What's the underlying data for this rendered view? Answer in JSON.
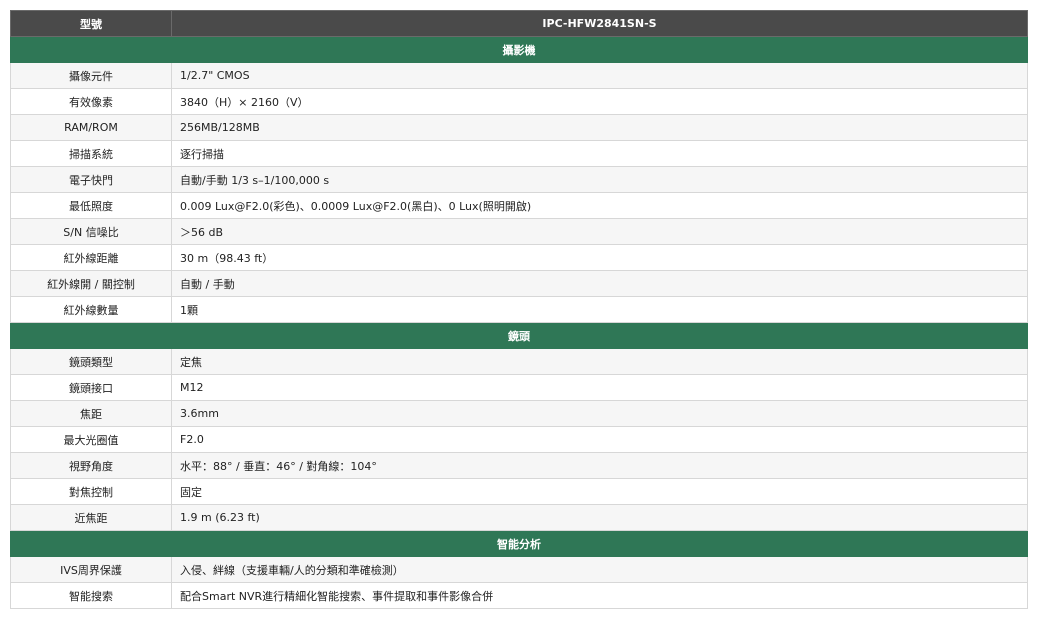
{
  "header": {
    "col1": "型號",
    "col2": "IPC-HFW2841SN-S"
  },
  "sections": [
    {
      "title": "攝影機",
      "rows": [
        {
          "label": "攝像元件",
          "value": "1/2.7\" CMOS"
        },
        {
          "label": "有效像素",
          "value": "3840（H）× 2160（V）"
        },
        {
          "label": "RAM/ROM",
          "value": "256MB/128MB"
        },
        {
          "label": "掃描系統",
          "value": "逐行掃描"
        },
        {
          "label": "電子快門",
          "value": "自動/手動 1/3 s–1/100,000 s"
        },
        {
          "label": "最低照度",
          "value": "0.009 Lux@F2.0(彩色)、0.0009 Lux@F2.0(黑白)、0 Lux(照明開啟)"
        },
        {
          "label": "S/N 信噪比",
          "value": "＞56 dB"
        },
        {
          "label": "紅外線距離",
          "value": "30 m（98.43 ft）"
        },
        {
          "label": "紅外線開 / 關控制",
          "value": "自動 / 手動"
        },
        {
          "label": "紅外線數量",
          "value": "1顆"
        }
      ]
    },
    {
      "title": "鏡頭",
      "rows": [
        {
          "label": "鏡頭類型",
          "value": "定焦"
        },
        {
          "label": "鏡頭接口",
          "value": "M12"
        },
        {
          "label": "焦距",
          "value": "3.6mm"
        },
        {
          "label": "最大光圈值",
          "value": "F2.0"
        },
        {
          "label": "視野角度",
          "value": "水平：88° / 垂直：46° / 對角線：104°"
        },
        {
          "label": "對焦控制",
          "value": "固定"
        },
        {
          "label": "近焦距",
          "value": "1.9 m (6.23 ft)"
        }
      ]
    },
    {
      "title": "智能分析",
      "rows": [
        {
          "label": "IVS周界保護",
          "value": "入侵、絆線（支援車輛/人的分類和準確檢測）"
        },
        {
          "label": "智能搜索",
          "value": "配合Smart NVR進行精細化智能搜索、事件提取和事件影像合併"
        }
      ]
    }
  ]
}
